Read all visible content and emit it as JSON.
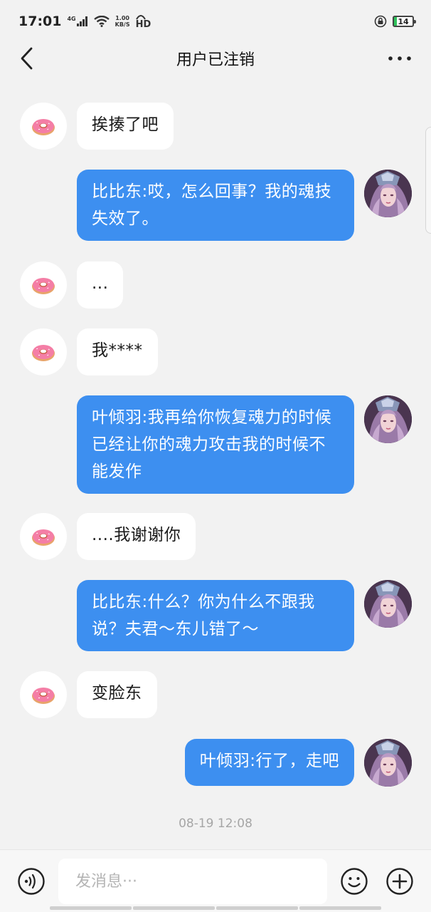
{
  "status_bar": {
    "time": "17:01",
    "network": "4G",
    "speed_value": "1.00",
    "speed_unit": "KB/S",
    "hd": "HD",
    "battery": "14"
  },
  "header": {
    "title": "用户已注销"
  },
  "messages": [
    {
      "side": "in",
      "text": "挨揍了吧"
    },
    {
      "side": "out",
      "text": "比比东:哎，怎么回事？我的魂技失效了。"
    },
    {
      "side": "in",
      "text": "..."
    },
    {
      "side": "in",
      "text": "我****"
    },
    {
      "side": "out",
      "text": "叶倾羽:我再给你恢复魂力的时候已经让你的魂力攻击我的时候不能发作"
    },
    {
      "side": "in",
      "text": "....我谢谢你"
    },
    {
      "side": "out",
      "text": "比比东:什么？你为什么不跟我说？夫君～东儿错了～"
    },
    {
      "side": "in",
      "text": "变脸东"
    },
    {
      "side": "out",
      "text": "叶倾羽:行了，走吧"
    }
  ],
  "timestamp": "08-19 12:08",
  "input": {
    "placeholder": "发消息···"
  },
  "colors": {
    "outgoing_bubble": "#3d8ff0",
    "incoming_bubble": "#ffffff",
    "background": "#f2f2f2"
  }
}
